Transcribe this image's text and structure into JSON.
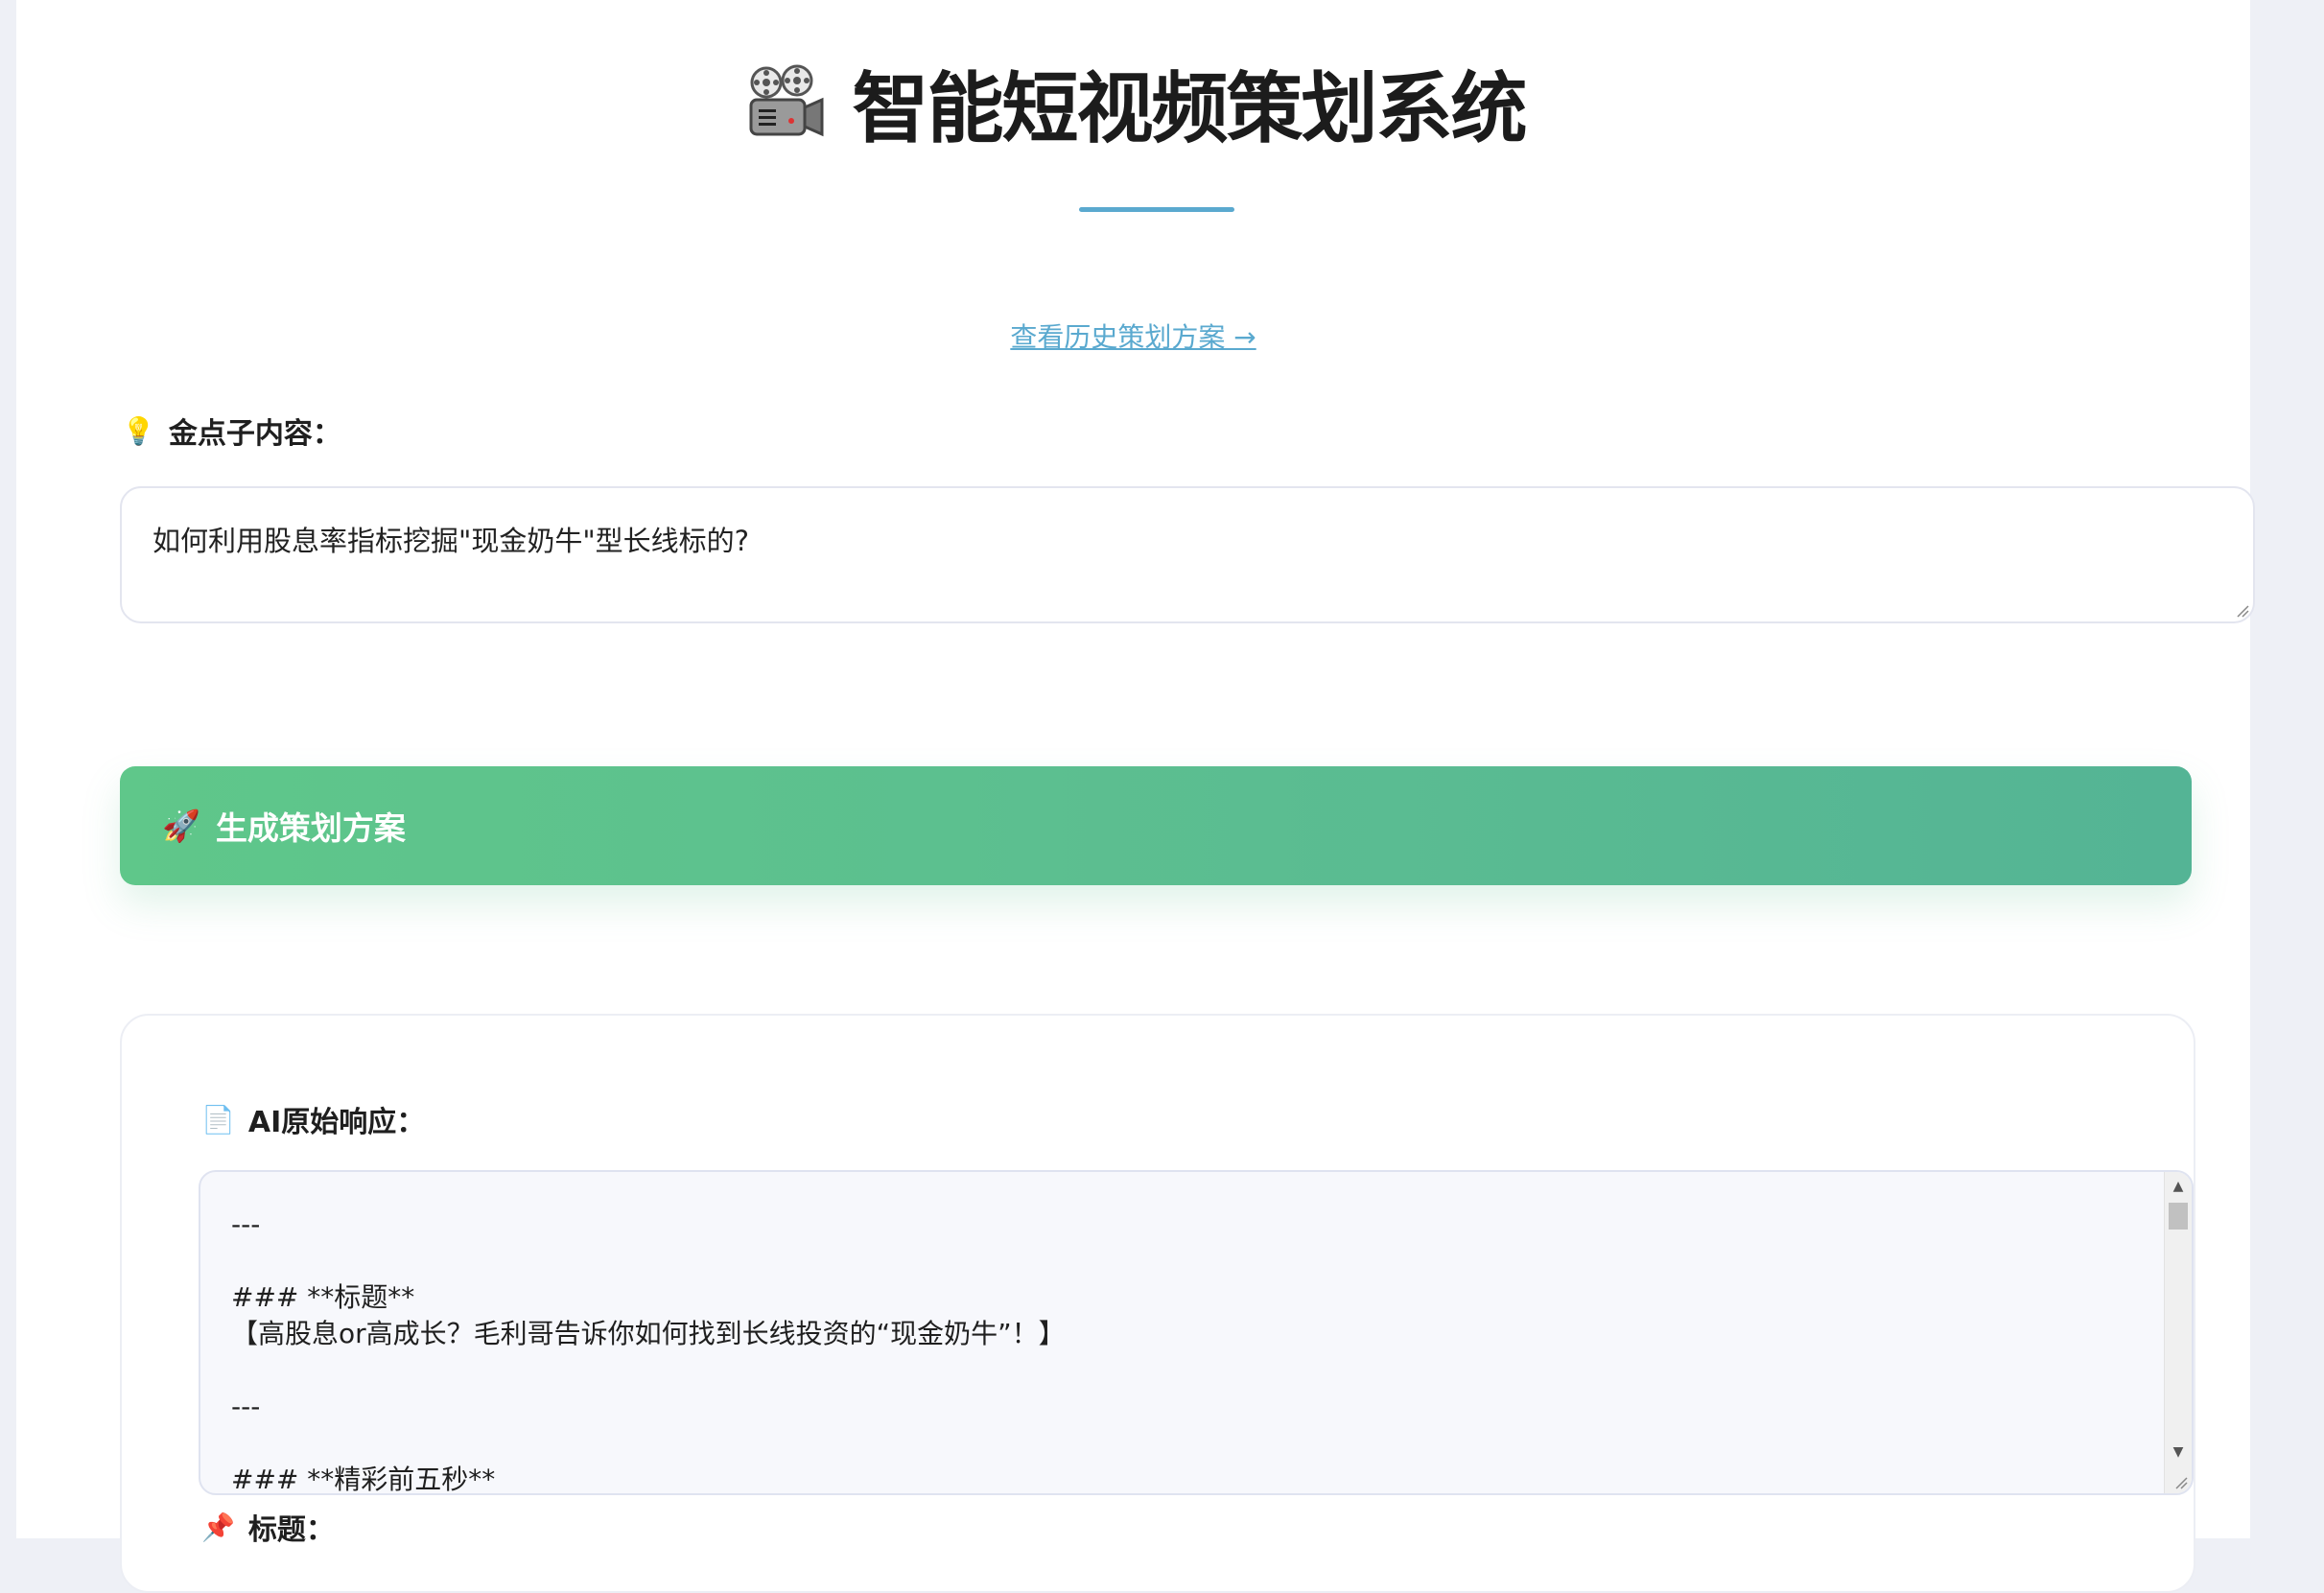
{
  "header": {
    "icon": "film-projector-icon",
    "title": "智能短视频策划系统"
  },
  "history_link": "查看历史策划方案 →",
  "idea": {
    "icon": "lightbulb-icon",
    "label": "金点子内容：",
    "value": "如何利用股息率指标挖掘\"现金奶牛\"型长线标的?"
  },
  "generate_button": {
    "icon": "rocket-icon",
    "label": "生成策划方案"
  },
  "result": {
    "ai_label_icon": "document-icon",
    "ai_label": "AI原始响应：",
    "ai_text": "---\n\n### **标题**\n【高股息or高成长？毛利哥告诉你如何找到长线投资的“现金奶牛”！】\n\n---\n\n### **精彩前五秒**",
    "title_field_icon": "pushpin-icon",
    "title_field_label": "标题："
  },
  "colors": {
    "accent": "#5aa9cf",
    "button_start": "#5fc78a",
    "button_end": "#54b495"
  }
}
